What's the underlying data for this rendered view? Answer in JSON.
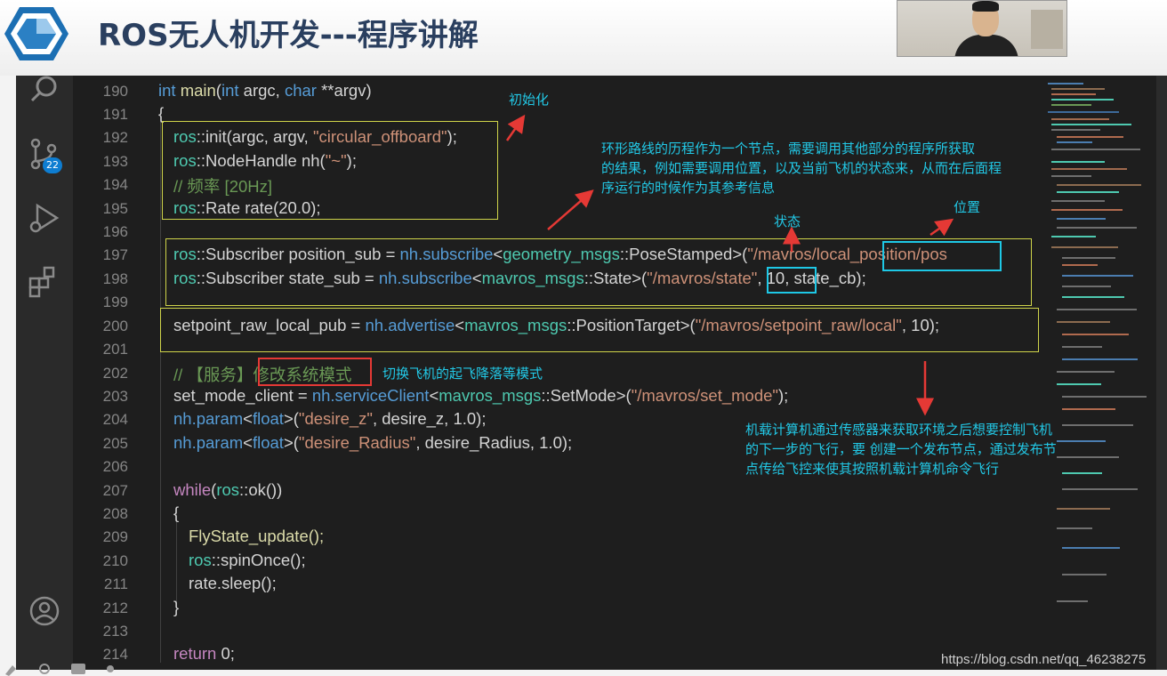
{
  "header": {
    "title": "ROS无人机开发---程序讲解"
  },
  "editor": {
    "line_numbers": [
      "190",
      "191",
      "192",
      "193",
      "194",
      "195",
      "196",
      "197",
      "198",
      "199",
      "200",
      "201",
      "202",
      "203",
      "204",
      "205",
      "206",
      "207",
      "208",
      "209",
      "210",
      "211",
      "212",
      "213",
      "214"
    ],
    "source_control_badge": "22",
    "icons": [
      "search-icon",
      "source-control-icon",
      "run-debug-icon",
      "extensions-icon",
      "account-icon"
    ]
  },
  "code": {
    "l190": {
      "kw1": "int",
      "fn": "main",
      "p1": "(",
      "kw2": "int",
      "t1": " argc, ",
      "kw3": "char",
      "t2": " **",
      "t3": "argv)"
    },
    "l191": "{",
    "l192": {
      "ns": "ros",
      "t1": "::init(argc, argv, ",
      "st": "\"circular_offboard\"",
      "t2": ");"
    },
    "l193": {
      "ns": "ros",
      "t1": "::NodeHandle nh(",
      "st": "\"~\"",
      "t2": ");"
    },
    "l194": "// 频率 [20Hz]",
    "l195": {
      "ns": "ros",
      "t1": "::Rate rate(20.0);"
    },
    "l197": {
      "ns": "ros",
      "t1": "::Subscriber position_sub = ",
      "nh": "nh.subscribe",
      "lt": "<",
      "ns2": "geometry_msgs",
      "t2": "::PoseStamped>(",
      "st": "\"/mavros/local_position/pos"
    },
    "l198": {
      "ns": "ros",
      "t1": "::Subscriber state_sub = ",
      "nh": "nh.subscribe",
      "lt": "<",
      "ns2": "mavros_msgs",
      "t2": "::State>(",
      "st": "\"/mavros/state\"",
      "t3": ", 10, state_cb);"
    },
    "l200": {
      "t1": "setpoint_raw_local_pub = ",
      "nh": "nh.advertise",
      "lt": "<",
      "ns2": "mavros_msgs",
      "t2": "::PositionTarget>(",
      "st": "\"/mavros/setpoint_raw/local\"",
      "t3": ", 10);"
    },
    "l202": "// 【服务】修改系统模式",
    "l203": {
      "t1": "set_mode_client = ",
      "nh": "nh.serviceClient",
      "lt": "<",
      "ns2": "mavros_msgs",
      "t2": "::SetMode>(",
      "st": "\"/mavros/set_mode\"",
      "t3": ");"
    },
    "l204": {
      "nh": "nh.param",
      "lt": "<",
      "kw": "float",
      "t2": ">(",
      "st": "\"desire_z\"",
      "t3": ", desire_z, 1.0);"
    },
    "l205": {
      "nh": "nh.param",
      "lt": "<",
      "kw": "float",
      "t2": ">(",
      "st": "\"desire_Radius\"",
      "t3": ", desire_Radius, 1.0);"
    },
    "l207": {
      "kw": "while",
      "t1": "(",
      "ns": "ros",
      "t2": "::ok())"
    },
    "l208": "{",
    "l209": "FlyState_update();",
    "l210": {
      "ns": "ros",
      "t1": "::spinOnce();"
    },
    "l211": "rate.sleep();",
    "l212": "}",
    "l214": {
      "kw": "return",
      "t1": " 0;"
    }
  },
  "annotations": {
    "init": "初始化",
    "node_desc_1": "环形路线的历程作为一个节点，需要调用其他部分的程序所获取",
    "node_desc_2": "的结果，例如需要调用位置，以及当前飞机的状态来，从而在后面程",
    "node_desc_3": "序运行的时候作为其参考信息",
    "state": "状态",
    "position": "位置",
    "mode_switch": "切换飞机的起飞降落等模式",
    "publish_1": "机载计算机通过传感器来获取环境之后想要控制飞机",
    "publish_2": "的下一步的飞行，要 创建一个发布节点，通过发布节",
    "publish_3": "点传给飞控来使其按照机载计算机命令飞行"
  },
  "watermark": "https://blog.csdn.net/qq_46238275",
  "colors": {
    "annotation_text": "#22c8e6",
    "box_yellow": "#cfd44a",
    "box_cyan": "#1ec8e6",
    "box_red": "#e53935",
    "arrow_red": "#e53935",
    "title": "#2a3f5f"
  }
}
